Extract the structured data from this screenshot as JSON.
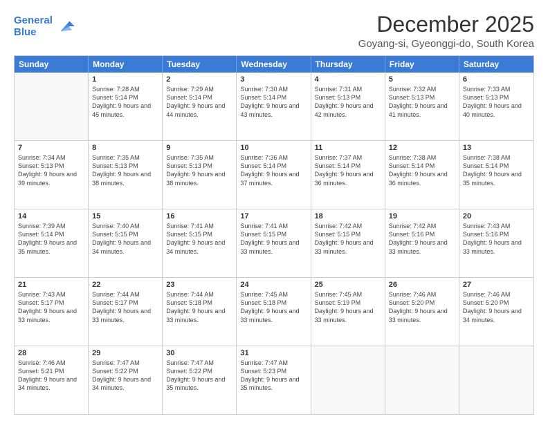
{
  "logo": {
    "line1": "General",
    "line2": "Blue"
  },
  "title": "December 2025",
  "subtitle": "Goyang-si, Gyeonggi-do, South Korea",
  "header_days": [
    "Sunday",
    "Monday",
    "Tuesday",
    "Wednesday",
    "Thursday",
    "Friday",
    "Saturday"
  ],
  "weeks": [
    [
      {
        "day": "",
        "sunrise": "",
        "sunset": "",
        "daylight": ""
      },
      {
        "day": "1",
        "sunrise": "Sunrise: 7:28 AM",
        "sunset": "Sunset: 5:14 PM",
        "daylight": "Daylight: 9 hours and 45 minutes."
      },
      {
        "day": "2",
        "sunrise": "Sunrise: 7:29 AM",
        "sunset": "Sunset: 5:14 PM",
        "daylight": "Daylight: 9 hours and 44 minutes."
      },
      {
        "day": "3",
        "sunrise": "Sunrise: 7:30 AM",
        "sunset": "Sunset: 5:14 PM",
        "daylight": "Daylight: 9 hours and 43 minutes."
      },
      {
        "day": "4",
        "sunrise": "Sunrise: 7:31 AM",
        "sunset": "Sunset: 5:13 PM",
        "daylight": "Daylight: 9 hours and 42 minutes."
      },
      {
        "day": "5",
        "sunrise": "Sunrise: 7:32 AM",
        "sunset": "Sunset: 5:13 PM",
        "daylight": "Daylight: 9 hours and 41 minutes."
      },
      {
        "day": "6",
        "sunrise": "Sunrise: 7:33 AM",
        "sunset": "Sunset: 5:13 PM",
        "daylight": "Daylight: 9 hours and 40 minutes."
      }
    ],
    [
      {
        "day": "7",
        "sunrise": "Sunrise: 7:34 AM",
        "sunset": "Sunset: 5:13 PM",
        "daylight": "Daylight: 9 hours and 39 minutes."
      },
      {
        "day": "8",
        "sunrise": "Sunrise: 7:35 AM",
        "sunset": "Sunset: 5:13 PM",
        "daylight": "Daylight: 9 hours and 38 minutes."
      },
      {
        "day": "9",
        "sunrise": "Sunrise: 7:35 AM",
        "sunset": "Sunset: 5:13 PM",
        "daylight": "Daylight: 9 hours and 38 minutes."
      },
      {
        "day": "10",
        "sunrise": "Sunrise: 7:36 AM",
        "sunset": "Sunset: 5:14 PM",
        "daylight": "Daylight: 9 hours and 37 minutes."
      },
      {
        "day": "11",
        "sunrise": "Sunrise: 7:37 AM",
        "sunset": "Sunset: 5:14 PM",
        "daylight": "Daylight: 9 hours and 36 minutes."
      },
      {
        "day": "12",
        "sunrise": "Sunrise: 7:38 AM",
        "sunset": "Sunset: 5:14 PM",
        "daylight": "Daylight: 9 hours and 36 minutes."
      },
      {
        "day": "13",
        "sunrise": "Sunrise: 7:38 AM",
        "sunset": "Sunset: 5:14 PM",
        "daylight": "Daylight: 9 hours and 35 minutes."
      }
    ],
    [
      {
        "day": "14",
        "sunrise": "Sunrise: 7:39 AM",
        "sunset": "Sunset: 5:14 PM",
        "daylight": "Daylight: 9 hours and 35 minutes."
      },
      {
        "day": "15",
        "sunrise": "Sunrise: 7:40 AM",
        "sunset": "Sunset: 5:15 PM",
        "daylight": "Daylight: 9 hours and 34 minutes."
      },
      {
        "day": "16",
        "sunrise": "Sunrise: 7:41 AM",
        "sunset": "Sunset: 5:15 PM",
        "daylight": "Daylight: 9 hours and 34 minutes."
      },
      {
        "day": "17",
        "sunrise": "Sunrise: 7:41 AM",
        "sunset": "Sunset: 5:15 PM",
        "daylight": "Daylight: 9 hours and 33 minutes."
      },
      {
        "day": "18",
        "sunrise": "Sunrise: 7:42 AM",
        "sunset": "Sunset: 5:15 PM",
        "daylight": "Daylight: 9 hours and 33 minutes."
      },
      {
        "day": "19",
        "sunrise": "Sunrise: 7:42 AM",
        "sunset": "Sunset: 5:16 PM",
        "daylight": "Daylight: 9 hours and 33 minutes."
      },
      {
        "day": "20",
        "sunrise": "Sunrise: 7:43 AM",
        "sunset": "Sunset: 5:16 PM",
        "daylight": "Daylight: 9 hours and 33 minutes."
      }
    ],
    [
      {
        "day": "21",
        "sunrise": "Sunrise: 7:43 AM",
        "sunset": "Sunset: 5:17 PM",
        "daylight": "Daylight: 9 hours and 33 minutes."
      },
      {
        "day": "22",
        "sunrise": "Sunrise: 7:44 AM",
        "sunset": "Sunset: 5:17 PM",
        "daylight": "Daylight: 9 hours and 33 minutes."
      },
      {
        "day": "23",
        "sunrise": "Sunrise: 7:44 AM",
        "sunset": "Sunset: 5:18 PM",
        "daylight": "Daylight: 9 hours and 33 minutes."
      },
      {
        "day": "24",
        "sunrise": "Sunrise: 7:45 AM",
        "sunset": "Sunset: 5:18 PM",
        "daylight": "Daylight: 9 hours and 33 minutes."
      },
      {
        "day": "25",
        "sunrise": "Sunrise: 7:45 AM",
        "sunset": "Sunset: 5:19 PM",
        "daylight": "Daylight: 9 hours and 33 minutes."
      },
      {
        "day": "26",
        "sunrise": "Sunrise: 7:46 AM",
        "sunset": "Sunset: 5:20 PM",
        "daylight": "Daylight: 9 hours and 33 minutes."
      },
      {
        "day": "27",
        "sunrise": "Sunrise: 7:46 AM",
        "sunset": "Sunset: 5:20 PM",
        "daylight": "Daylight: 9 hours and 34 minutes."
      }
    ],
    [
      {
        "day": "28",
        "sunrise": "Sunrise: 7:46 AM",
        "sunset": "Sunset: 5:21 PM",
        "daylight": "Daylight: 9 hours and 34 minutes."
      },
      {
        "day": "29",
        "sunrise": "Sunrise: 7:47 AM",
        "sunset": "Sunset: 5:22 PM",
        "daylight": "Daylight: 9 hours and 34 minutes."
      },
      {
        "day": "30",
        "sunrise": "Sunrise: 7:47 AM",
        "sunset": "Sunset: 5:22 PM",
        "daylight": "Daylight: 9 hours and 35 minutes."
      },
      {
        "day": "31",
        "sunrise": "Sunrise: 7:47 AM",
        "sunset": "Sunset: 5:23 PM",
        "daylight": "Daylight: 9 hours and 35 minutes."
      },
      {
        "day": "",
        "sunrise": "",
        "sunset": "",
        "daylight": ""
      },
      {
        "day": "",
        "sunrise": "",
        "sunset": "",
        "daylight": ""
      },
      {
        "day": "",
        "sunrise": "",
        "sunset": "",
        "daylight": ""
      }
    ]
  ]
}
